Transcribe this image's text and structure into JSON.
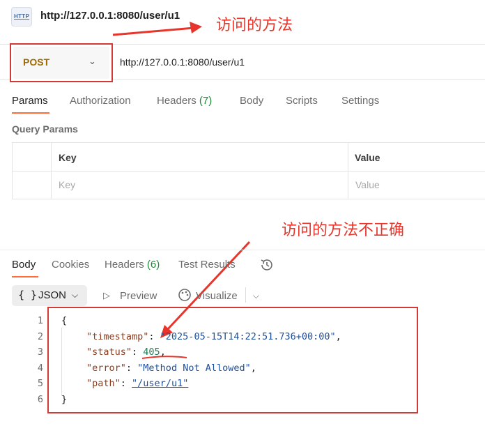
{
  "title_bar": {
    "icon": "http-request-icon",
    "icon_text": "HTTP",
    "request_name": "http://127.0.0.1:8080/user/u1"
  },
  "annotations": {
    "method_note": "访问的方法",
    "status_note": "访问的方法不正确",
    "color": "#e8352b"
  },
  "request": {
    "method": "POST",
    "method_color": "#a16b00",
    "url": "http://127.0.0.1:8080/user/u1",
    "tabs": [
      {
        "label": "Params",
        "active": true
      },
      {
        "label": "Authorization"
      },
      {
        "label": "Headers",
        "count": "(7)"
      },
      {
        "label": "Body"
      },
      {
        "label": "Scripts"
      },
      {
        "label": "Settings"
      }
    ],
    "query_params": {
      "title": "Query Params",
      "columns": [
        "Key",
        "Value"
      ],
      "placeholders": [
        "Key",
        "Value"
      ]
    }
  },
  "response": {
    "tabs": [
      {
        "label": "Body",
        "active": true
      },
      {
        "label": "Cookies"
      },
      {
        "label": "Headers",
        "count": "(6)"
      },
      {
        "label": "Test Results"
      }
    ],
    "toolbar": {
      "format": "JSON",
      "braces": "{ }",
      "preview": "Preview",
      "visualize": "Visualize"
    },
    "body": {
      "line_numbers": [
        "1",
        "2",
        "3",
        "4",
        "5",
        "6"
      ],
      "open_brace": "{",
      "close_brace": "}",
      "fields": [
        {
          "key": "\"timestamp\"",
          "value": "\"2025-05-15T14:22:51.736+00:00\"",
          "type": "string"
        },
        {
          "key": "\"status\"",
          "value": "405",
          "type": "number"
        },
        {
          "key": "\"error\"",
          "value": "\"Method Not Allowed\"",
          "type": "string"
        },
        {
          "key": "\"path\"",
          "value": "\"/user/u1\"",
          "type": "link"
        }
      ]
    }
  },
  "accent_color": "#ff6c37"
}
